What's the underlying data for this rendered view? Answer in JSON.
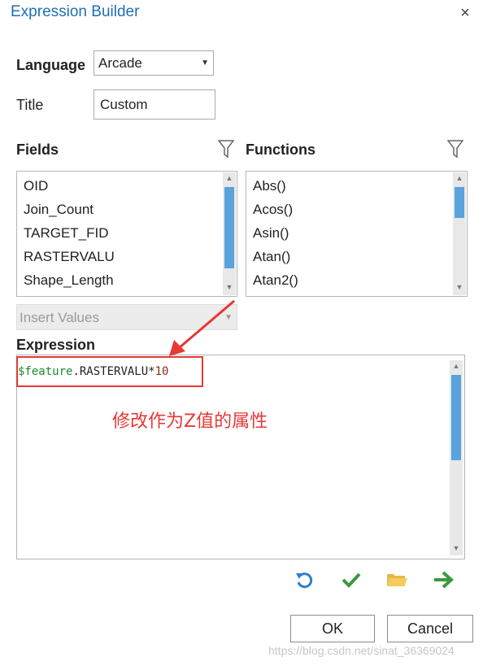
{
  "window": {
    "title": "Expression Builder",
    "close_glyph": "×"
  },
  "language": {
    "label": "Language",
    "value": "Arcade"
  },
  "title_field": {
    "label": "Title",
    "value": "Custom"
  },
  "fields": {
    "label": "Fields",
    "filter_icon": "filter-icon",
    "items": [
      "OID",
      "Join_Count",
      "TARGET_FID",
      "RASTERVALU",
      "Shape_Length"
    ]
  },
  "functions": {
    "label": "Functions",
    "filter_icon": "filter-icon",
    "items": [
      "Abs()",
      "Acos()",
      "Asin()",
      "Atan()",
      "Atan2()"
    ]
  },
  "insert_values": {
    "value": "Insert Values"
  },
  "expression": {
    "label": "Expression",
    "code_var": "$feature",
    "code_field": ".RASTERVALU",
    "code_op": "*",
    "code_num": "10"
  },
  "annotation": {
    "text": "修改作为Z值的属性",
    "color": "#e53935"
  },
  "toolbar": {
    "icons": [
      "undo-icon",
      "verify-icon",
      "open-folder-icon",
      "run-arrow-icon"
    ]
  },
  "buttons": {
    "ok": "OK",
    "cancel": "Cancel"
  },
  "watermark": "https://blog.csdn.net/sinat_36369024"
}
